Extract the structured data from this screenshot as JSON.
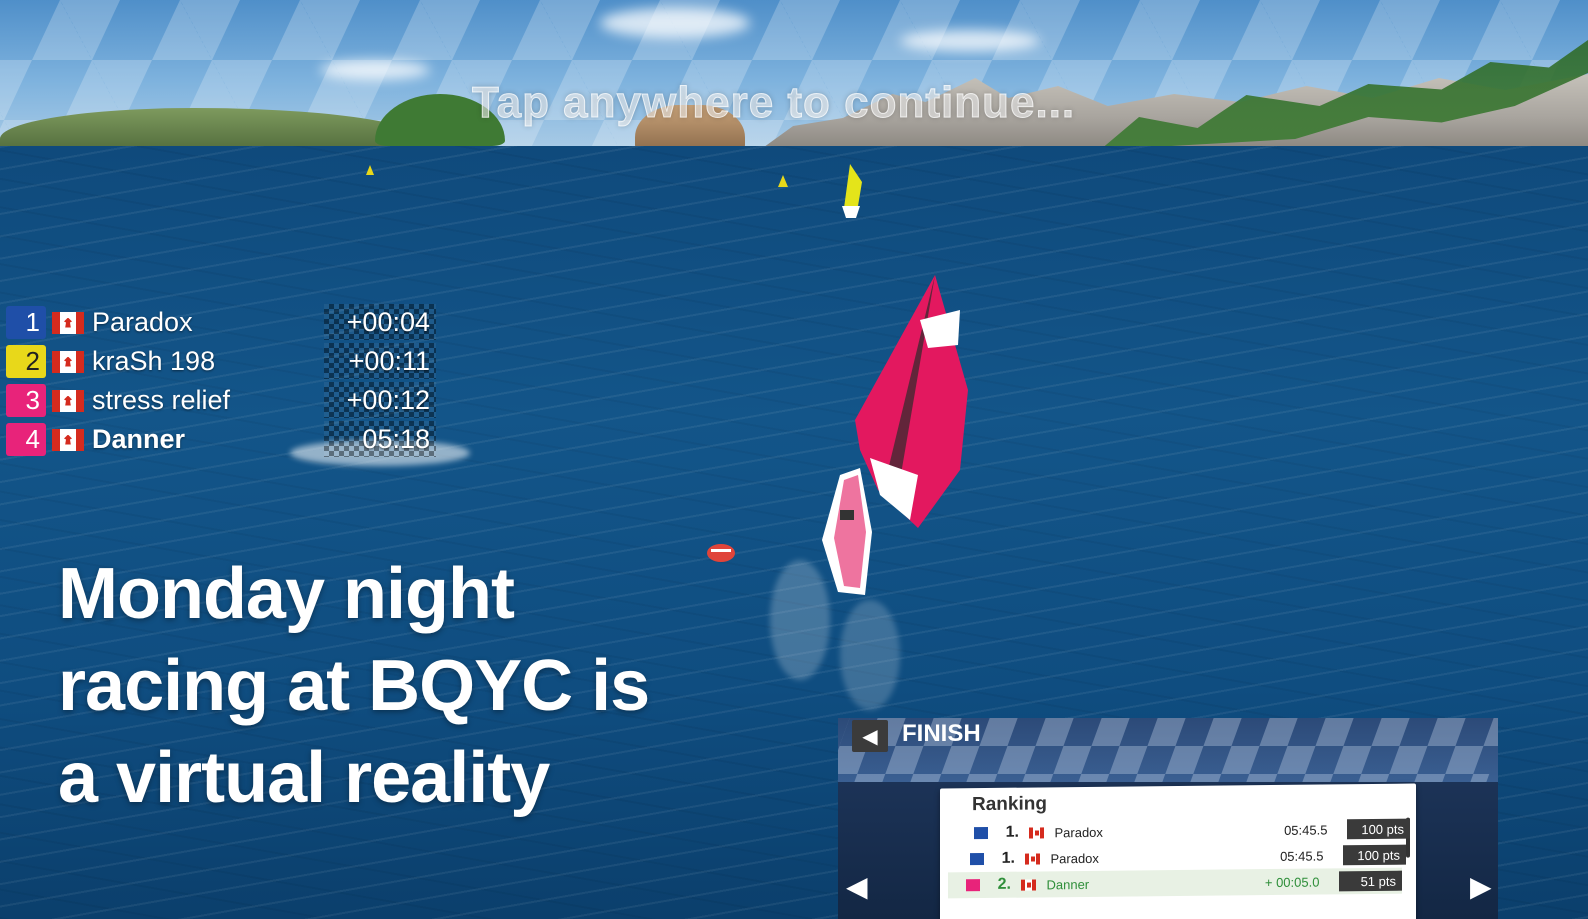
{
  "tap_prompt": "Tap anywhere to continue...",
  "leaderboard": [
    {
      "position": "1",
      "color": "#1f4fa8",
      "flag": "canada-flag-icon",
      "name": "Paradox",
      "time": "+00:04"
    },
    {
      "position": "2",
      "color": "#e8d81a",
      "flag": "canada-flag-icon",
      "name": "kraSh 198",
      "time": "+00:11"
    },
    {
      "position": "3",
      "color": "#e8237a",
      "flag": "canada-flag-icon",
      "name": "stress relief",
      "time": "+00:12"
    },
    {
      "position": "4",
      "color": "#e8237a",
      "flag": "canada-flag-icon",
      "name": "Danner",
      "time": "05:18"
    }
  ],
  "headline": {
    "line1": "Monday night",
    "line2": "racing at BQYC is",
    "line3": "a virtual reality"
  },
  "finish_panel": {
    "title": "FINISH",
    "ranking_title": "Ranking",
    "back_icon": "back-arrow-icon",
    "rows": [
      {
        "swatch": "#1f4fa8",
        "position": "1.",
        "name": "Paradox",
        "time": "05:45.5",
        "points": "100 pts",
        "highlight": false
      },
      {
        "swatch": "#1f4fa8",
        "position": "1.",
        "name": "Paradox",
        "time": "05:45.5",
        "points": "100 pts",
        "highlight": false
      },
      {
        "swatch": "#e8237a",
        "position": "2.",
        "name": "Danner",
        "time": "+ 00:05.0",
        "points": "51 pts",
        "highlight": true
      }
    ]
  }
}
